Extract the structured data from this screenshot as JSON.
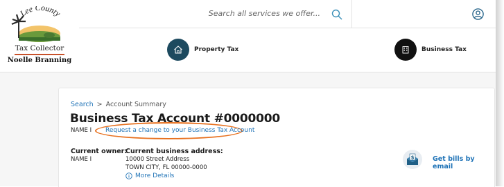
{
  "brand": {
    "logo_arc_text": "Lee County",
    "office": "Tax Collector",
    "official": "Noelle Branning",
    "accent": "#c8512a"
  },
  "search": {
    "placeholder": "Search all services we offer..."
  },
  "header": {
    "user_icon": "user-circle-icon"
  },
  "nav": {
    "items": [
      {
        "label": "Property Tax",
        "icon": "house-icon",
        "color": "#1d4a5f"
      },
      {
        "label": "Business Tax",
        "icon": "building-icon",
        "color": "#111111"
      }
    ]
  },
  "breadcrumb": {
    "link": "Search",
    "separator": ">",
    "current": "Account Summary"
  },
  "account": {
    "title": "Business Tax Account #0000000",
    "name": "NAME I",
    "request_change_link": "Request a change to your Business Tax Account",
    "owner_label": "Current owner:",
    "owner_value": "NAME I",
    "address_label": "Current business address:",
    "address_line1": "10000 Street Address",
    "address_line2": "TOWN CITY, FL 00000-0000",
    "more_details": "More Details"
  },
  "actions": {
    "bills_by_email": "Get bills by email"
  },
  "colors": {
    "link": "#1f73b7",
    "highlight": "#e8711f"
  }
}
